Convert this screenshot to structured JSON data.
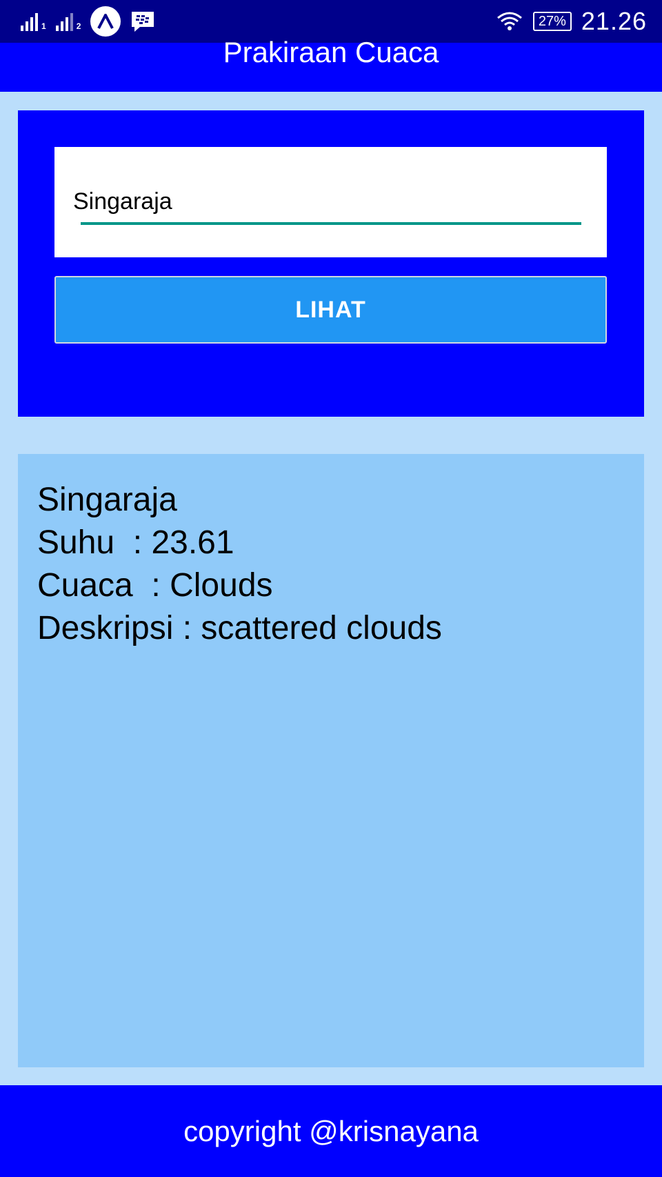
{
  "status_bar": {
    "sim1_label": "1",
    "sim2_label": "2",
    "battery": "27%",
    "time": "21.26"
  },
  "app_bar": {
    "title": "Prakiraan Cuaca"
  },
  "form": {
    "city_value": "Singaraja",
    "button_label": "LIHAT"
  },
  "result": {
    "city": "Singaraja",
    "temperature": "Suhu  : 23.61",
    "weather": "Cuaca  : Clouds",
    "description": "Deskripsi : scattered clouds"
  },
  "footer": {
    "text": "copyright @krisnayana"
  },
  "colors": {
    "status_bar": "#00008b",
    "primary": "#0000ff",
    "background": "#bbdefb",
    "result_bg": "#90caf9",
    "button": "#2196f3",
    "input_underline": "#009688"
  }
}
